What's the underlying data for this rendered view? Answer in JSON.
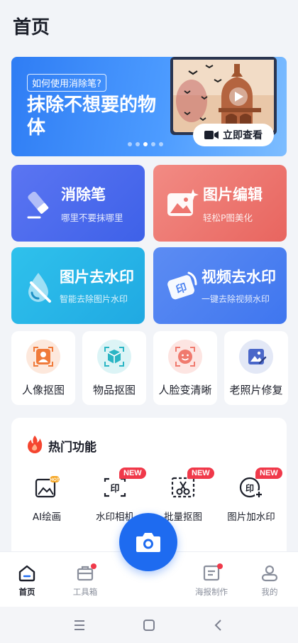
{
  "header": {
    "title": "首页"
  },
  "banner": {
    "tag": "如何使用消除笔?",
    "headline": "抹除不想要的物体",
    "cta_label": "立即查看",
    "slide_count": 5,
    "active_slide": 3
  },
  "feature_cards": [
    {
      "title": "消除笔",
      "subtitle": "哪里不要抹哪里",
      "icon": "eraser-pen-icon",
      "color": "#4a6cf0"
    },
    {
      "title": "图片编辑",
      "subtitle": "轻松P图美化",
      "icon": "image-edit-icon",
      "color": "#ee7670"
    },
    {
      "title": "图片去水印",
      "subtitle": "智能去除图片水印",
      "icon": "image-watermark-remove-icon",
      "color": "#26b6e8"
    },
    {
      "title": "视频去水印",
      "subtitle": "一键去除视频水印",
      "icon": "video-watermark-remove-icon",
      "color": "#4b82f1"
    }
  ],
  "quick_tools": [
    {
      "label": "人像抠图",
      "icon": "portrait-cutout-icon",
      "color": "#f07a3a"
    },
    {
      "label": "物品抠图",
      "icon": "object-cutout-icon",
      "color": "#2bb5c4"
    },
    {
      "label": "人脸变清晰",
      "icon": "face-enhance-icon",
      "color": "#f07a6e"
    },
    {
      "label": "老照片修复",
      "icon": "photo-restore-icon",
      "color": "#4a67c9"
    }
  ],
  "hot_section": {
    "title": "热门功能",
    "items": [
      {
        "label": "AI绘画",
        "badge": "",
        "icon": "ai-painting-icon"
      },
      {
        "label": "水印相机",
        "badge": "NEW",
        "icon": "watermark-camera-icon"
      },
      {
        "label": "批量抠图",
        "badge": "NEW",
        "icon": "batch-cutout-icon"
      },
      {
        "label": "图片加水印",
        "badge": "NEW",
        "icon": "add-watermark-icon"
      }
    ]
  },
  "bottom_nav": {
    "items": [
      {
        "label": "首页",
        "active": true,
        "icon": "home-icon"
      },
      {
        "label": "工具箱",
        "active": false,
        "icon": "toolbox-icon",
        "dot": true
      },
      {
        "label": "海报制作",
        "active": false,
        "icon": "poster-icon",
        "dot": true
      },
      {
        "label": "我的",
        "active": false,
        "icon": "profile-icon"
      }
    ],
    "fab_icon": "camera-icon"
  },
  "colors": {
    "primary": "#1e6bf0",
    "badge_red": "#f0394a",
    "page_bg": "#f2f4f8"
  }
}
